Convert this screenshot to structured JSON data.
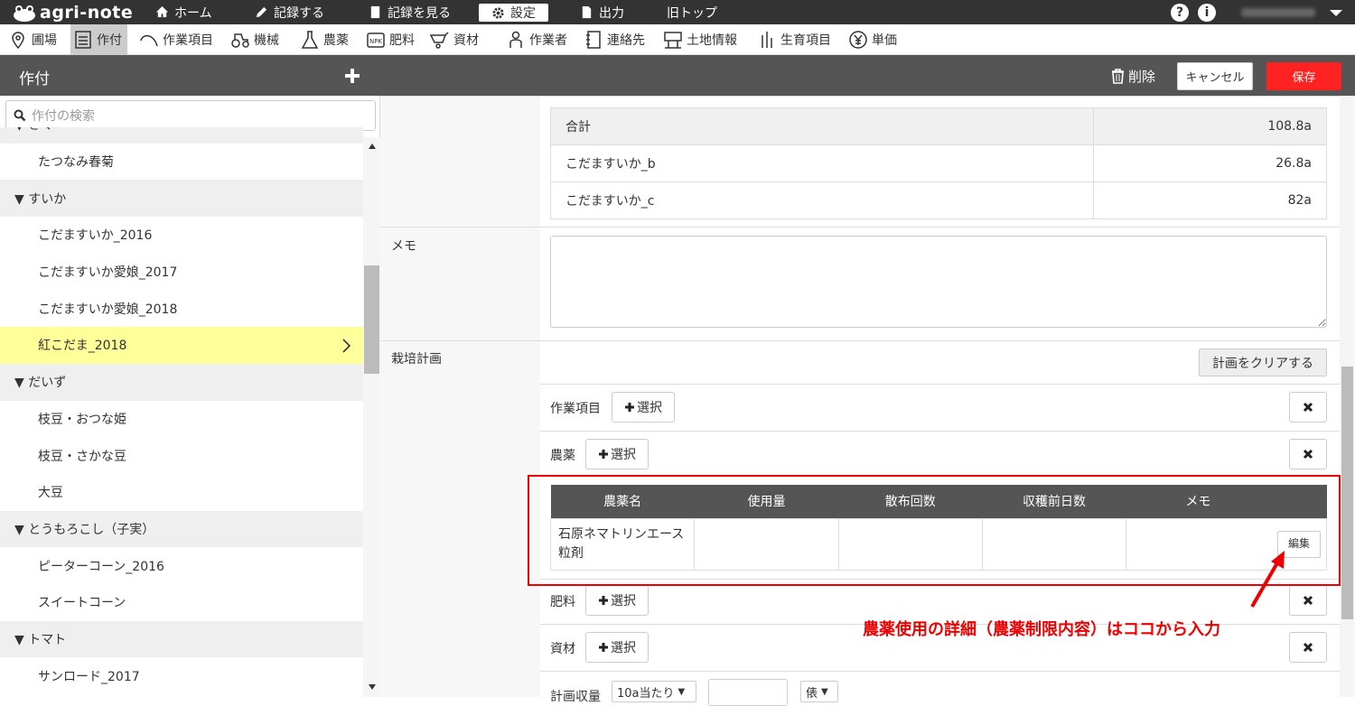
{
  "app": {
    "logo": "agri-note"
  },
  "topnav": {
    "items": [
      {
        "label": "ホーム"
      },
      {
        "label": "記録する"
      },
      {
        "label": "記録を見る"
      },
      {
        "label": "設定"
      },
      {
        "label": "出力"
      },
      {
        "label": "旧トップ"
      }
    ],
    "help": "?",
    "info": "i"
  },
  "subnav": {
    "items": [
      {
        "label": "圃場"
      },
      {
        "label": "作付"
      },
      {
        "label": "作業項目"
      },
      {
        "label": "機械"
      },
      {
        "label": "農薬"
      },
      {
        "label": "肥料"
      },
      {
        "label": "資材"
      },
      {
        "label": "作業者"
      },
      {
        "label": "連絡先"
      },
      {
        "label": "土地情報"
      },
      {
        "label": "生育項目"
      },
      {
        "label": "単価"
      }
    ],
    "npk": "NPK"
  },
  "header": {
    "title": "作付",
    "delete": "削除",
    "cancel": "キャンセル",
    "save": "保存"
  },
  "sidebar": {
    "search_placeholder": "作付の検索",
    "tree": [
      {
        "label": "▼ きく",
        "type": "group"
      },
      {
        "label": "たつなみ春菊",
        "type": "leaf"
      },
      {
        "label": "▼ すいか",
        "type": "group"
      },
      {
        "label": "こだますいか_2016",
        "type": "leaf"
      },
      {
        "label": "こだますいか愛娘_2017",
        "type": "leaf"
      },
      {
        "label": "こだますいか愛娘_2018",
        "type": "leaf"
      },
      {
        "label": "紅こだま_2018",
        "type": "leaf",
        "selected": true
      },
      {
        "label": "▼ だいず",
        "type": "group"
      },
      {
        "label": "枝豆・おつな姫",
        "type": "leaf"
      },
      {
        "label": "枝豆・さかな豆",
        "type": "leaf"
      },
      {
        "label": "大豆",
        "type": "leaf"
      },
      {
        "label": "▼ とうもろこし（子実）",
        "type": "group"
      },
      {
        "label": "ピーターコーン_2016",
        "type": "leaf"
      },
      {
        "label": "スイートコーン",
        "type": "leaf"
      },
      {
        "label": "▼ トマト",
        "type": "group"
      },
      {
        "label": "サンロード_2017",
        "type": "leaf"
      }
    ]
  },
  "main": {
    "area_table": [
      {
        "name": "合計",
        "value": "108.8a"
      },
      {
        "name": "こだますいか_b",
        "value": "26.8a"
      },
      {
        "name": "こだますいか_c",
        "value": "82a"
      }
    ],
    "memo_label": "メモ",
    "plan_label": "栽培計画",
    "clear_plan": "計画をクリアする",
    "plan_rows": [
      {
        "label": "作業項目"
      },
      {
        "label": "農薬"
      },
      {
        "label": "肥料"
      },
      {
        "label": "資材"
      }
    ],
    "select_label": "選択",
    "pesticide_table": {
      "headers": [
        "農薬名",
        "使用量",
        "散布回数",
        "収穫前日数",
        "メモ"
      ],
      "rows": [
        {
          "name": "石原ネマトリンエース粒剤",
          "amount": "",
          "times": "",
          "days": "",
          "memo": "",
          "edit": "編集"
        }
      ]
    },
    "yield_label": "計画収量",
    "yield_unit_select": "10a当たり",
    "yield_unit2": "俵"
  },
  "annotation": "農薬使用の詳細（農薬制限内容）はココから入力",
  "colors": {
    "topbar": "#333333",
    "header": "#555555",
    "save": "#ff2222",
    "selected_row": "#ffff99",
    "annotation": "#ee0000"
  }
}
